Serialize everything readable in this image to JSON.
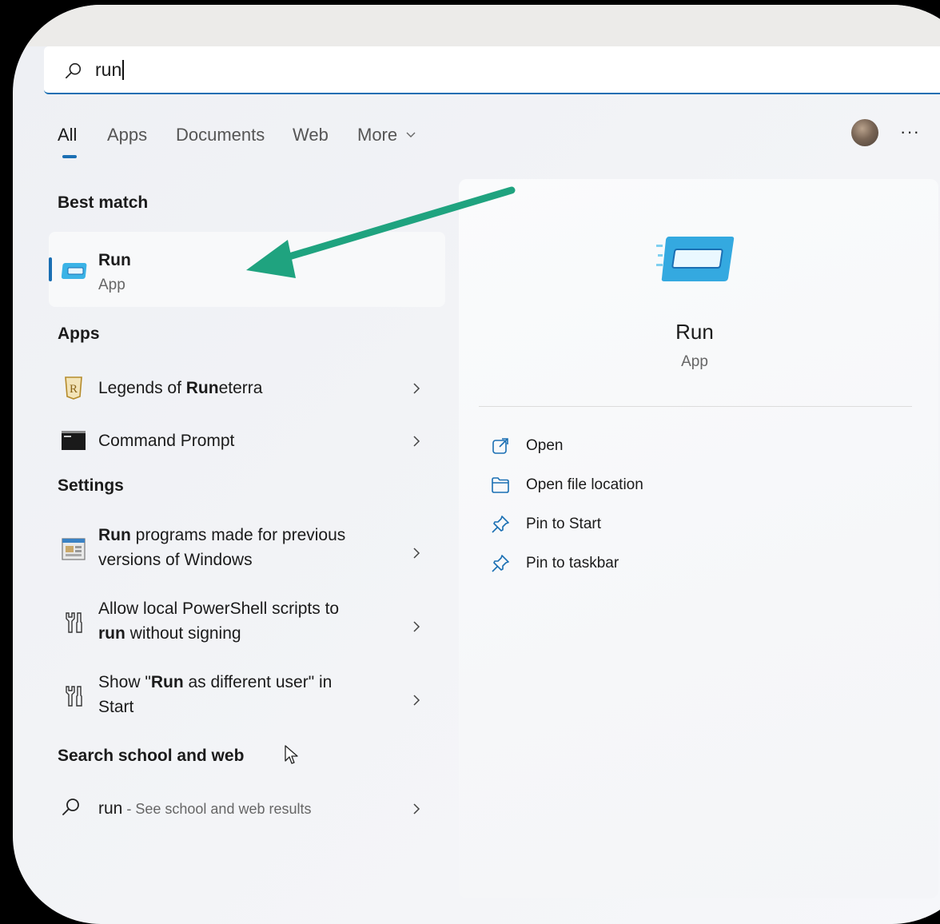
{
  "search": {
    "query": "run"
  },
  "tabs": [
    {
      "label": "All",
      "active": true
    },
    {
      "label": "Apps"
    },
    {
      "label": "Documents"
    },
    {
      "label": "Web"
    },
    {
      "label": "More"
    }
  ],
  "header": {
    "more_menu": "···"
  },
  "sections": {
    "best_match": "Best match",
    "apps": "Apps",
    "settings": "Settings",
    "web": "Search school and web"
  },
  "best_match": {
    "name": "Run",
    "type": "App"
  },
  "apps": [
    {
      "pre": "Legends of ",
      "bold": "Run",
      "post": "eterra",
      "icon": "runeterra-icon"
    },
    {
      "pre": "Command Prompt",
      "bold": "",
      "post": "",
      "icon": "command-prompt-icon"
    }
  ],
  "settings": [
    {
      "line1_bold": "Run",
      "line1_rest": " programs made for previous",
      "line2": "versions of Windows"
    },
    {
      "line1": "Allow local PowerShell scripts to",
      "line2_bold": "run",
      "line2_rest": " without signing"
    },
    {
      "line1_pre": "Show \"",
      "line1_bold": "Run",
      "line1_post": " as different user\" in",
      "line2": "Start"
    }
  ],
  "web_result": {
    "query": "run",
    "suffix": " - See school and web results"
  },
  "preview": {
    "name": "Run",
    "type": "App",
    "actions": [
      {
        "label": "Open",
        "icon": "open-external-icon"
      },
      {
        "label": "Open file location",
        "icon": "folder-icon"
      },
      {
        "label": "Pin to Start",
        "icon": "pin-icon"
      },
      {
        "label": "Pin to taskbar",
        "icon": "pin-icon"
      }
    ]
  },
  "colors": {
    "accent": "#1a6fb3",
    "annotation_arrow": "#1fa37f"
  }
}
